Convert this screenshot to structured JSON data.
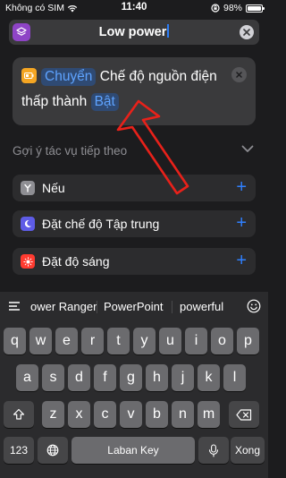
{
  "status_bar": {
    "carrier": "Không có SIM",
    "time": "11:40",
    "battery": "98%",
    "battery_level": 0.98
  },
  "header": {
    "title_value": "Low power",
    "app_icon": "layers-icon",
    "clear_icon": "close-icon"
  },
  "action": {
    "icon": "battery-icon",
    "verb": "Chuyển",
    "text": "Chế độ nguồn điện thấp thành",
    "value": "Bật",
    "close_icon": "close-icon"
  },
  "suggestions": {
    "title": "Gợi ý tác vụ tiếp theo",
    "items": [
      {
        "label": "Nếu",
        "icon": "branch-icon",
        "color": "#8e8e93"
      },
      {
        "label": "Đặt chế độ Tập trung",
        "icon": "moon-icon",
        "color": "#5e5ce6"
      },
      {
        "label": "Đặt độ sáng",
        "icon": "sun-icon",
        "color": "#ff3b30"
      }
    ]
  },
  "keyboard": {
    "predictions": [
      "ower Ranger",
      "PowerPoint",
      "powerful"
    ],
    "row1": [
      "q",
      "w",
      "e",
      "r",
      "t",
      "y",
      "u",
      "i",
      "o",
      "p"
    ],
    "row2": [
      "a",
      "s",
      "d",
      "f",
      "g",
      "h",
      "j",
      "k",
      "l"
    ],
    "row3": [
      "z",
      "x",
      "c",
      "v",
      "b",
      "n",
      "m"
    ],
    "numbers_key": "123",
    "space_label": "Laban Key",
    "return_label": "Xong"
  },
  "colors": {
    "accent": "#2f80ff",
    "arrow": "#e8211a",
    "pill_bg": "#2f4a73"
  }
}
